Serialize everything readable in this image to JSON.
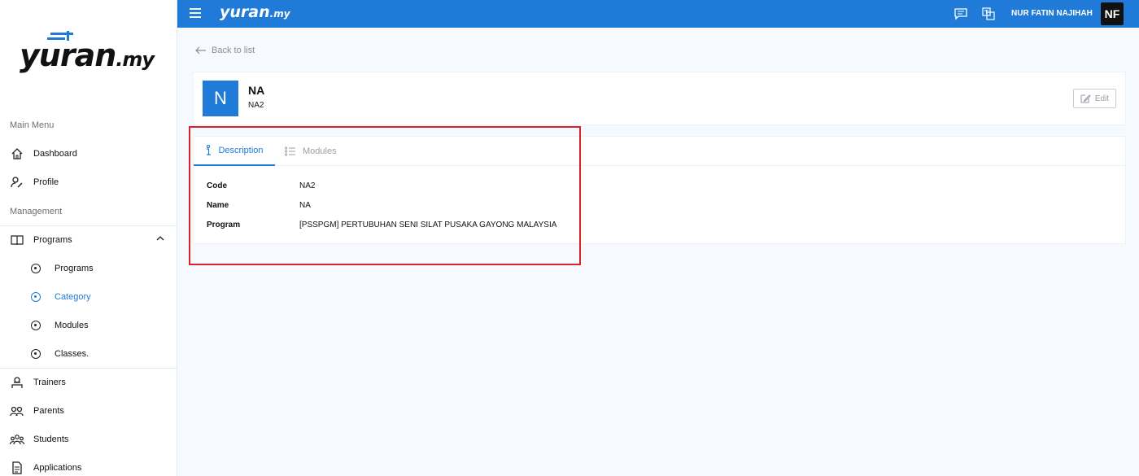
{
  "brand": {
    "logo_main": "yuran",
    "logo_suffix": ".my"
  },
  "topbar": {
    "user_name": "NUR FATIN NAJIHAH",
    "avatar_initials": "NF"
  },
  "sidebar": {
    "main_menu_label": "Main Menu",
    "management_label": "Management",
    "items": [
      {
        "label": "Dashboard"
      },
      {
        "label": "Profile"
      },
      {
        "label": "Programs"
      },
      {
        "label": "Programs"
      },
      {
        "label": "Category"
      },
      {
        "label": "Modules"
      },
      {
        "label": "Classes."
      },
      {
        "label": "Trainers"
      },
      {
        "label": "Parents"
      },
      {
        "label": "Students"
      },
      {
        "label": "Applications"
      }
    ]
  },
  "page": {
    "back_label": "Back to list",
    "avatar_letter": "N",
    "title": "NA",
    "subtitle": "NA2",
    "edit_label": "Edit",
    "tabs": [
      {
        "label": "Description"
      },
      {
        "label": "Modules"
      }
    ],
    "details": [
      {
        "label": "Code",
        "value": "NA2"
      },
      {
        "label": "Name",
        "value": "NA"
      },
      {
        "label": "Program",
        "value": "[PSSPGM] PERTUBUHAN SENI SILAT PUSAKA GAYONG MALAYSIA"
      }
    ]
  },
  "colors": {
    "primary": "#1f7ad8",
    "highlight": "#d9222a"
  }
}
